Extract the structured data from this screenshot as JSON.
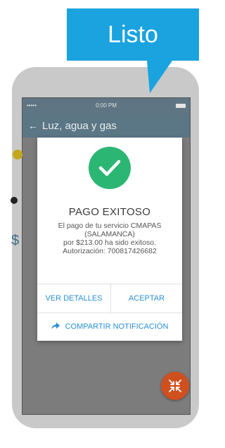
{
  "callout": {
    "label": "Listo"
  },
  "statusbar": {
    "signal": "•••••",
    "time": "0:00 PM"
  },
  "navbar": {
    "back_icon": "arrow-left-icon",
    "title": "Luz, agua y gas"
  },
  "background": {
    "amount_glyph": "$"
  },
  "dialog": {
    "title": "PAGO EXITOSO",
    "message_lines": [
      "El pago de tu servicio CMAPAS",
      "(SALAMANCA)",
      "por $213.00 ha sido exitoso.",
      "Autorización: 700817426682"
    ],
    "details_label": "VER DETALLES",
    "accept_label": "ACEPTAR",
    "share_label": "COMPARTIR NOTIFICACIÓN"
  },
  "colors": {
    "success": "#2cb673",
    "accent": "#2a8fd6",
    "callout": "#1aa3df",
    "fab": "#cf4f1f"
  }
}
